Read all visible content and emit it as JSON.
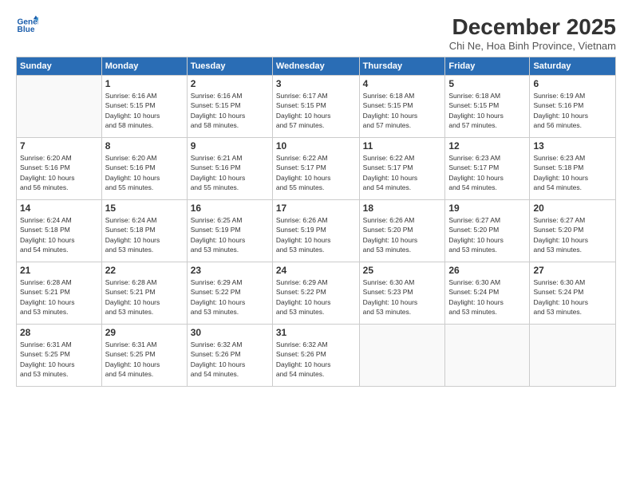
{
  "logo": {
    "line1": "General",
    "line2": "Blue"
  },
  "title": "December 2025",
  "subtitle": "Chi Ne, Hoa Binh Province, Vietnam",
  "header_days": [
    "Sunday",
    "Monday",
    "Tuesday",
    "Wednesday",
    "Thursday",
    "Friday",
    "Saturday"
  ],
  "weeks": [
    [
      {
        "day": "",
        "info": ""
      },
      {
        "day": "1",
        "info": "Sunrise: 6:16 AM\nSunset: 5:15 PM\nDaylight: 10 hours\nand 58 minutes."
      },
      {
        "day": "2",
        "info": "Sunrise: 6:16 AM\nSunset: 5:15 PM\nDaylight: 10 hours\nand 58 minutes."
      },
      {
        "day": "3",
        "info": "Sunrise: 6:17 AM\nSunset: 5:15 PM\nDaylight: 10 hours\nand 57 minutes."
      },
      {
        "day": "4",
        "info": "Sunrise: 6:18 AM\nSunset: 5:15 PM\nDaylight: 10 hours\nand 57 minutes."
      },
      {
        "day": "5",
        "info": "Sunrise: 6:18 AM\nSunset: 5:15 PM\nDaylight: 10 hours\nand 57 minutes."
      },
      {
        "day": "6",
        "info": "Sunrise: 6:19 AM\nSunset: 5:16 PM\nDaylight: 10 hours\nand 56 minutes."
      }
    ],
    [
      {
        "day": "7",
        "info": "Sunrise: 6:20 AM\nSunset: 5:16 PM\nDaylight: 10 hours\nand 56 minutes."
      },
      {
        "day": "8",
        "info": "Sunrise: 6:20 AM\nSunset: 5:16 PM\nDaylight: 10 hours\nand 55 minutes."
      },
      {
        "day": "9",
        "info": "Sunrise: 6:21 AM\nSunset: 5:16 PM\nDaylight: 10 hours\nand 55 minutes."
      },
      {
        "day": "10",
        "info": "Sunrise: 6:22 AM\nSunset: 5:17 PM\nDaylight: 10 hours\nand 55 minutes."
      },
      {
        "day": "11",
        "info": "Sunrise: 6:22 AM\nSunset: 5:17 PM\nDaylight: 10 hours\nand 54 minutes."
      },
      {
        "day": "12",
        "info": "Sunrise: 6:23 AM\nSunset: 5:17 PM\nDaylight: 10 hours\nand 54 minutes."
      },
      {
        "day": "13",
        "info": "Sunrise: 6:23 AM\nSunset: 5:18 PM\nDaylight: 10 hours\nand 54 minutes."
      }
    ],
    [
      {
        "day": "14",
        "info": "Sunrise: 6:24 AM\nSunset: 5:18 PM\nDaylight: 10 hours\nand 54 minutes."
      },
      {
        "day": "15",
        "info": "Sunrise: 6:24 AM\nSunset: 5:18 PM\nDaylight: 10 hours\nand 53 minutes."
      },
      {
        "day": "16",
        "info": "Sunrise: 6:25 AM\nSunset: 5:19 PM\nDaylight: 10 hours\nand 53 minutes."
      },
      {
        "day": "17",
        "info": "Sunrise: 6:26 AM\nSunset: 5:19 PM\nDaylight: 10 hours\nand 53 minutes."
      },
      {
        "day": "18",
        "info": "Sunrise: 6:26 AM\nSunset: 5:20 PM\nDaylight: 10 hours\nand 53 minutes."
      },
      {
        "day": "19",
        "info": "Sunrise: 6:27 AM\nSunset: 5:20 PM\nDaylight: 10 hours\nand 53 minutes."
      },
      {
        "day": "20",
        "info": "Sunrise: 6:27 AM\nSunset: 5:20 PM\nDaylight: 10 hours\nand 53 minutes."
      }
    ],
    [
      {
        "day": "21",
        "info": "Sunrise: 6:28 AM\nSunset: 5:21 PM\nDaylight: 10 hours\nand 53 minutes."
      },
      {
        "day": "22",
        "info": "Sunrise: 6:28 AM\nSunset: 5:21 PM\nDaylight: 10 hours\nand 53 minutes."
      },
      {
        "day": "23",
        "info": "Sunrise: 6:29 AM\nSunset: 5:22 PM\nDaylight: 10 hours\nand 53 minutes."
      },
      {
        "day": "24",
        "info": "Sunrise: 6:29 AM\nSunset: 5:22 PM\nDaylight: 10 hours\nand 53 minutes."
      },
      {
        "day": "25",
        "info": "Sunrise: 6:30 AM\nSunset: 5:23 PM\nDaylight: 10 hours\nand 53 minutes."
      },
      {
        "day": "26",
        "info": "Sunrise: 6:30 AM\nSunset: 5:24 PM\nDaylight: 10 hours\nand 53 minutes."
      },
      {
        "day": "27",
        "info": "Sunrise: 6:30 AM\nSunset: 5:24 PM\nDaylight: 10 hours\nand 53 minutes."
      }
    ],
    [
      {
        "day": "28",
        "info": "Sunrise: 6:31 AM\nSunset: 5:25 PM\nDaylight: 10 hours\nand 53 minutes."
      },
      {
        "day": "29",
        "info": "Sunrise: 6:31 AM\nSunset: 5:25 PM\nDaylight: 10 hours\nand 54 minutes."
      },
      {
        "day": "30",
        "info": "Sunrise: 6:32 AM\nSunset: 5:26 PM\nDaylight: 10 hours\nand 54 minutes."
      },
      {
        "day": "31",
        "info": "Sunrise: 6:32 AM\nSunset: 5:26 PM\nDaylight: 10 hours\nand 54 minutes."
      },
      {
        "day": "",
        "info": ""
      },
      {
        "day": "",
        "info": ""
      },
      {
        "day": "",
        "info": ""
      }
    ]
  ]
}
